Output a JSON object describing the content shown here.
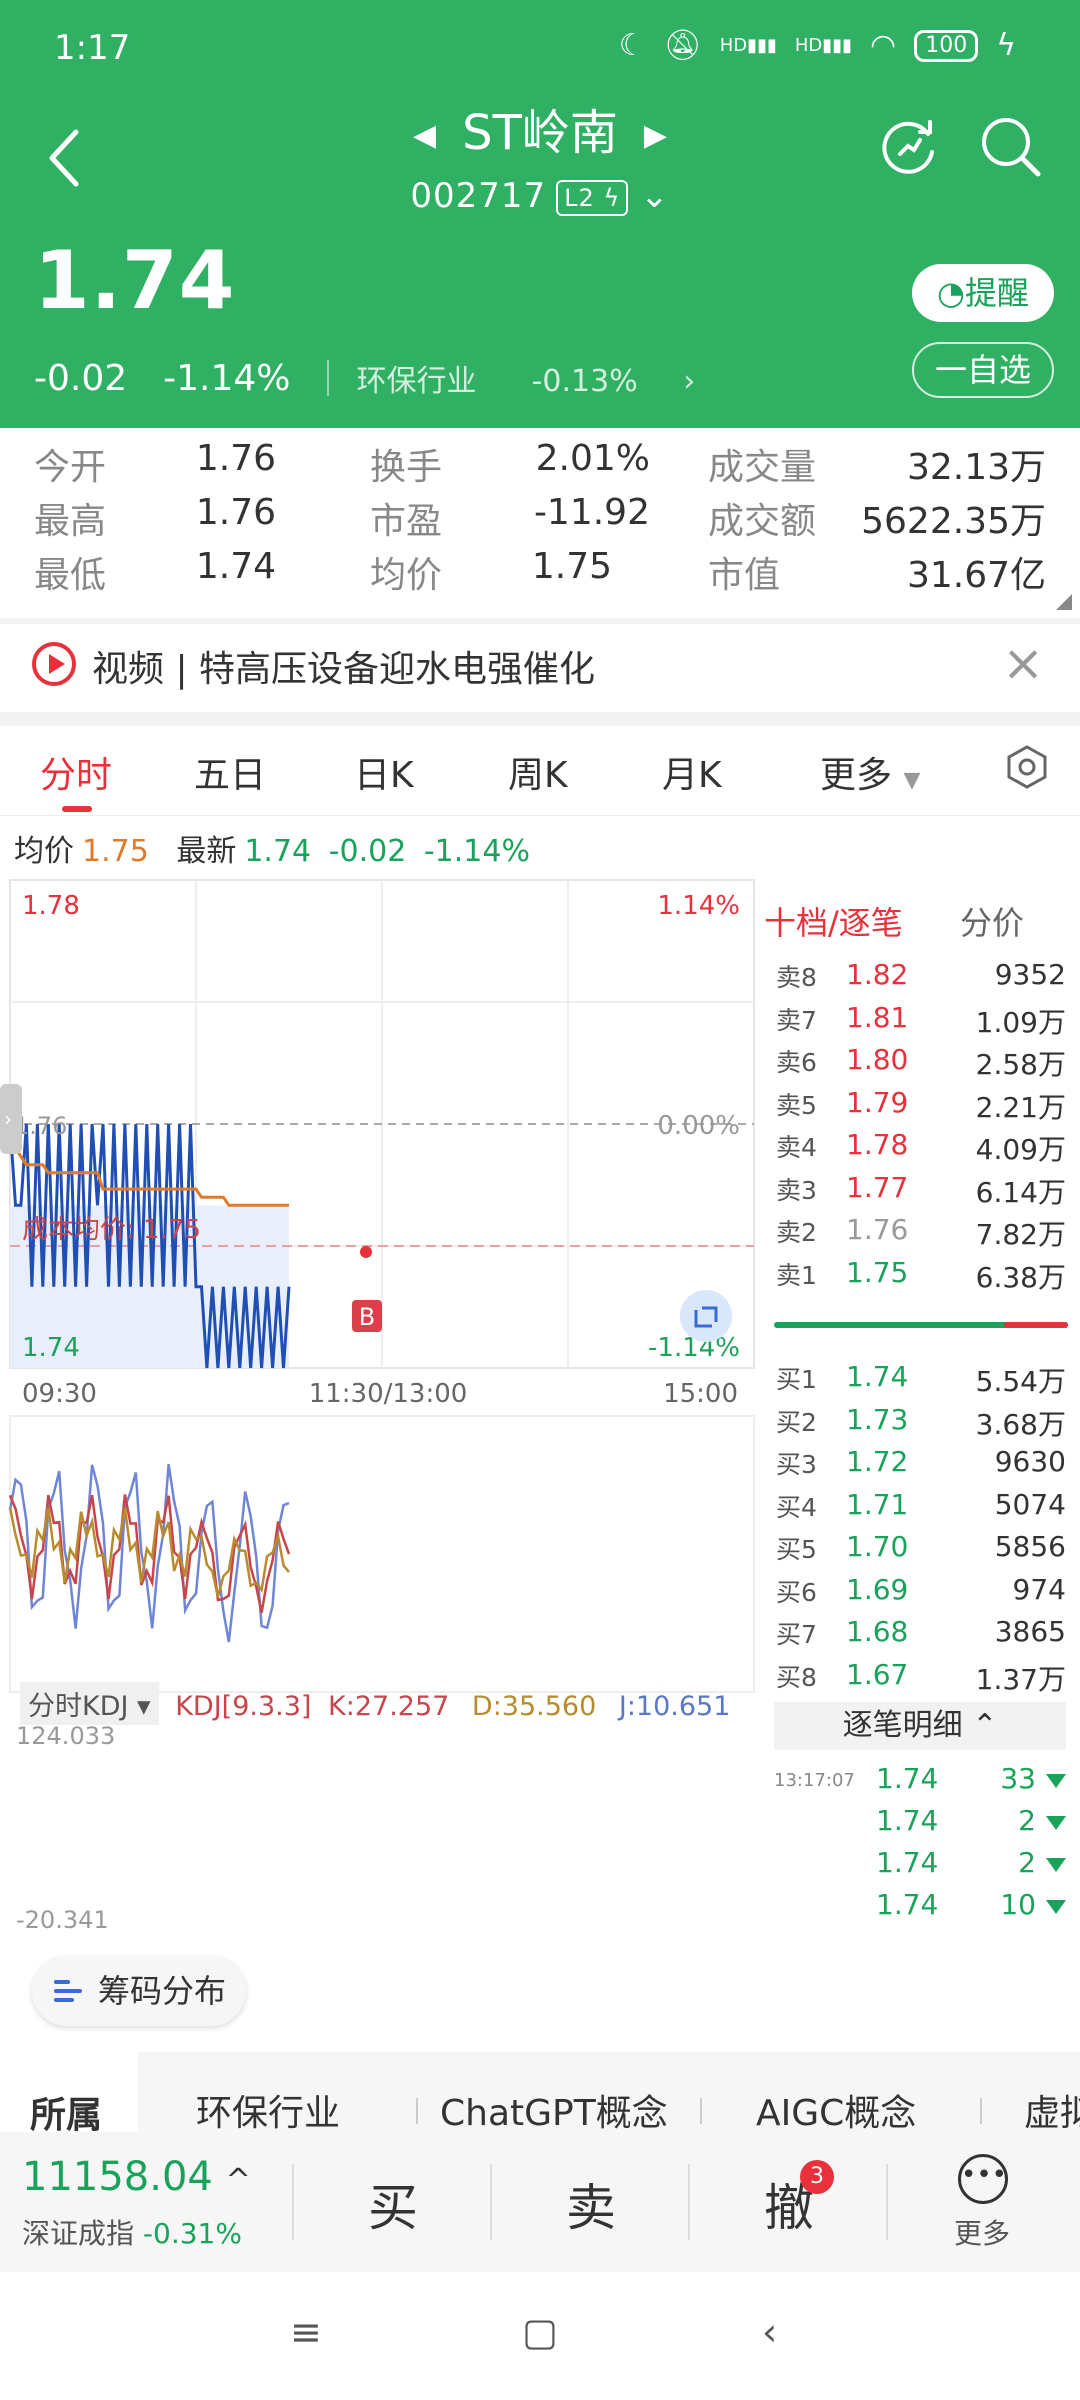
{
  "status": {
    "time": "1:17",
    "battery": "100",
    "hd1": "HD",
    "hd2": "HD"
  },
  "header": {
    "title": "ST岭南",
    "code": "002717",
    "level": "L2",
    "price": "1.74",
    "change": "-0.02",
    "change_pct": "-1.14%",
    "industry": "环保行业",
    "industry_pct": "-0.13%",
    "remind_label": "提醒",
    "watch_label": "一自选"
  },
  "quote": {
    "rows": [
      [
        {
          "label": "今开",
          "value": "1.76"
        },
        {
          "label": "换手",
          "value": "2.01%"
        },
        {
          "label": "成交量",
          "value": "32.13万"
        }
      ],
      [
        {
          "label": "最高",
          "value": "1.76"
        },
        {
          "label": "市盈",
          "value": "-11.92"
        },
        {
          "label": "成交额",
          "value": "5622.35万"
        }
      ],
      [
        {
          "label": "最低",
          "value": "1.74"
        },
        {
          "label": "均价",
          "value": "1.75"
        },
        {
          "label": "市值",
          "value": "31.67亿"
        }
      ]
    ]
  },
  "news": {
    "text": "视频 | 特高压设备迎水电强催化"
  },
  "tabs": [
    "分时",
    "五日",
    "日K",
    "周K",
    "月K",
    "更多"
  ],
  "info": {
    "avg_label": "均价",
    "avg": "1.75",
    "latest_label": "最新",
    "latest": "1.74",
    "chg": "-0.02",
    "pct": "-1.14%"
  },
  "chart_data": {
    "type": "line",
    "y_max_label": "1.78",
    "y_min_label": "1.74",
    "y_mid_label": "1.76",
    "pct_max_label": "1.14%",
    "pct_mid_label": "0.00%",
    "pct_min_label": "-1.14%",
    "x_labels": [
      "09:30",
      "11:30/13:00",
      "15:00"
    ],
    "cost_label": "成本均价: 1.75",
    "marker": "B",
    "ylim": [
      1.74,
      1.78
    ],
    "price_series": [
      1.76,
      1.75,
      1.75,
      1.76,
      1.74,
      1.76,
      1.74,
      1.76,
      1.74,
      1.76,
      1.74,
      1.76,
      1.74,
      1.76,
      1.74,
      1.76,
      1.75,
      1.76,
      1.74,
      1.76,
      1.74,
      1.76,
      1.74,
      1.76,
      1.74,
      1.76,
      1.74,
      1.76,
      1.74,
      1.76,
      1.74,
      1.76,
      1.74,
      1.76,
      1.74,
      1.74,
      1.73,
      1.74,
      1.73,
      1.74,
      1.73,
      1.74,
      1.73,
      1.74,
      1.73,
      1.74,
      1.73,
      1.74,
      1.73,
      1.74,
      1.73,
      1.74
    ],
    "avg_series": [
      1.76,
      1.757,
      1.756,
      1.755,
      1.755,
      1.755,
      1.755,
      1.754,
      1.754,
      1.754,
      1.754,
      1.754,
      1.754,
      1.754,
      1.754,
      1.754,
      1.754,
      1.752,
      1.752,
      1.752,
      1.752,
      1.752,
      1.752,
      1.752,
      1.752,
      1.752,
      1.752,
      1.752,
      1.752,
      1.752,
      1.752,
      1.752,
      1.752,
      1.752,
      1.752,
      1.751,
      1.751,
      1.751,
      1.751,
      1.751,
      1.75,
      1.75,
      1.75,
      1.75,
      1.75,
      1.75,
      1.75,
      1.75,
      1.75,
      1.75,
      1.75,
      1.75
    ]
  },
  "kdj": {
    "select_label": "分时KDJ",
    "params": "KDJ[9.3.3]",
    "k": "K:27.257",
    "d": "D:35.560",
    "j": "J:10.651",
    "max": "124.033",
    "min": "-20.341"
  },
  "orderbook": {
    "tab1": "十档/逐笔",
    "tab2": "分价",
    "sells": [
      {
        "label": "卖8",
        "price": "1.82",
        "vol": "9352",
        "dir": "up"
      },
      {
        "label": "卖7",
        "price": "1.81",
        "vol": "1.09万",
        "dir": "up"
      },
      {
        "label": "卖6",
        "price": "1.80",
        "vol": "2.58万",
        "dir": "up"
      },
      {
        "label": "卖5",
        "price": "1.79",
        "vol": "2.21万",
        "dir": "up"
      },
      {
        "label": "卖4",
        "price": "1.78",
        "vol": "4.09万",
        "dir": "up"
      },
      {
        "label": "卖3",
        "price": "1.77",
        "vol": "6.14万",
        "dir": "up"
      },
      {
        "label": "卖2",
        "price": "1.76",
        "vol": "7.82万",
        "dir": "flat"
      },
      {
        "label": "卖1",
        "price": "1.75",
        "vol": "6.38万",
        "dir": "down"
      }
    ],
    "buys": [
      {
        "label": "买1",
        "price": "1.74",
        "vol": "5.54万"
      },
      {
        "label": "买2",
        "price": "1.73",
        "vol": "3.68万"
      },
      {
        "label": "买3",
        "price": "1.72",
        "vol": "9630"
      },
      {
        "label": "买4",
        "price": "1.71",
        "vol": "5074"
      },
      {
        "label": "买5",
        "price": "1.70",
        "vol": "5856"
      },
      {
        "label": "买6",
        "price": "1.69",
        "vol": "974"
      },
      {
        "label": "买7",
        "price": "1.68",
        "vol": "3865"
      },
      {
        "label": "买8",
        "price": "1.67",
        "vol": "1.37万"
      }
    ],
    "ticks_header": "逐笔明细",
    "ticks": [
      {
        "time": "13:17:07",
        "price": "1.74",
        "qty": "33"
      },
      {
        "time": "",
        "price": "1.74",
        "qty": "2"
      },
      {
        "time": "",
        "price": "1.74",
        "qty": "2"
      },
      {
        "time": "",
        "price": "1.74",
        "qty": "10"
      }
    ]
  },
  "chip_button": "筹码分布",
  "concepts": [
    "所属",
    "环保行业",
    "ChatGPT概念",
    "AIGC概念",
    "虚拟"
  ],
  "tradebar": {
    "index_value": "11158.04",
    "index_name": "深证成指",
    "index_pct": "-0.31%",
    "buy": "买",
    "sell": "卖",
    "cancel": "撤",
    "badge": "3",
    "more": "更多"
  }
}
